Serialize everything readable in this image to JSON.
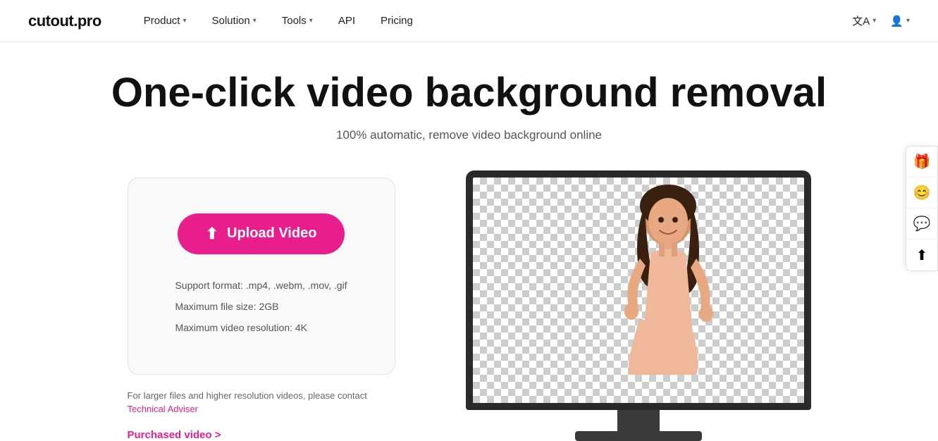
{
  "logo": {
    "text": "cutout.pro"
  },
  "nav": {
    "items": [
      {
        "label": "Product",
        "hasDropdown": true
      },
      {
        "label": "Solution",
        "hasDropdown": true
      },
      {
        "label": "Tools",
        "hasDropdown": true
      },
      {
        "label": "API",
        "hasDropdown": false
      },
      {
        "label": "Pricing",
        "hasDropdown": false
      }
    ],
    "lang_label": "文A",
    "user_icon": "👤"
  },
  "hero": {
    "title": "One-click video background removal",
    "subtitle": "100% automatic, remove video background online"
  },
  "upload": {
    "button_label": "Upload Video",
    "support_format": "Support format: .mp4, .webm, .mov, .gif",
    "max_size": "Maximum file size: 2GB",
    "max_resolution": "Maximum video resolution: 4K",
    "contact_note": "For larger files and higher resolution videos, please contact",
    "contact_link_label": "Technical Adviser",
    "purchased_label": "Purchased video >"
  },
  "side_panel": {
    "buttons": [
      {
        "icon": "🎁",
        "name": "gift-icon"
      },
      {
        "icon": "😊",
        "name": "face-icon"
      },
      {
        "icon": "💬",
        "name": "feedback-icon"
      },
      {
        "icon": "⬆",
        "name": "upload-icon"
      }
    ]
  }
}
